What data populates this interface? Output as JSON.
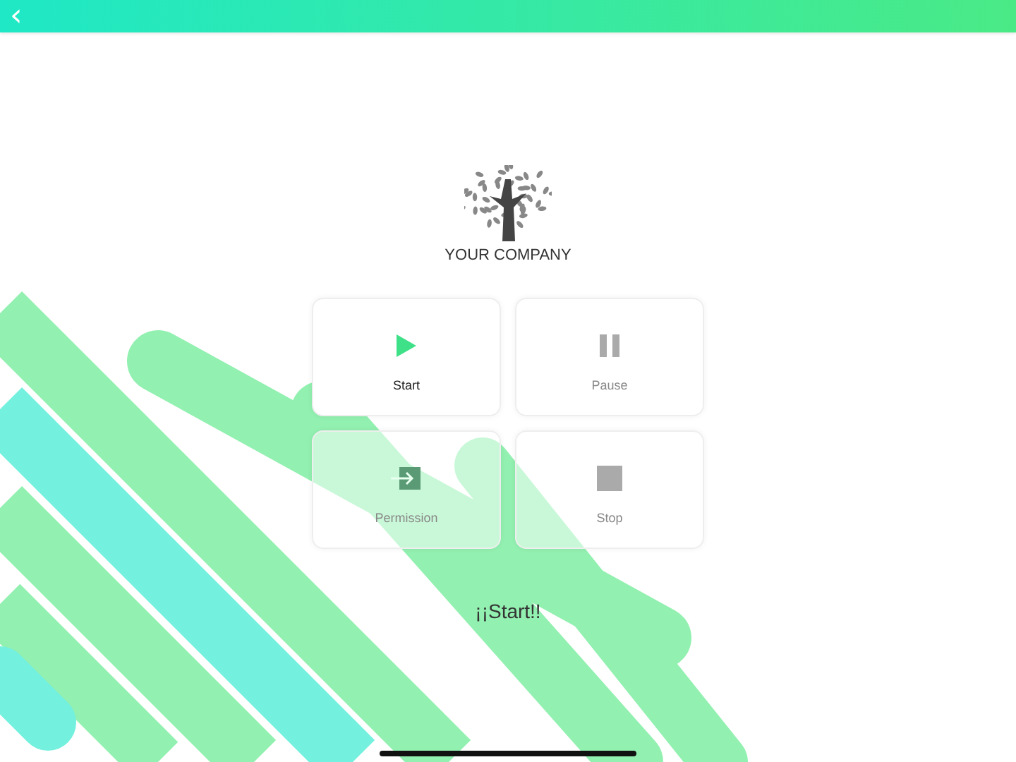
{
  "top_bar": {
    "back_icon": "‹"
  },
  "logo": {
    "company": "YOUR COMPANY"
  },
  "buttons": [
    {
      "label": "Start",
      "kind": "play",
      "disabled": false
    },
    {
      "label": "Pause",
      "kind": "pause",
      "disabled": true
    },
    {
      "label": "Permission",
      "kind": "enter",
      "disabled": true
    },
    {
      "label": "Stop",
      "kind": "stop",
      "disabled": true
    }
  ],
  "status": "¡¡Start!!"
}
